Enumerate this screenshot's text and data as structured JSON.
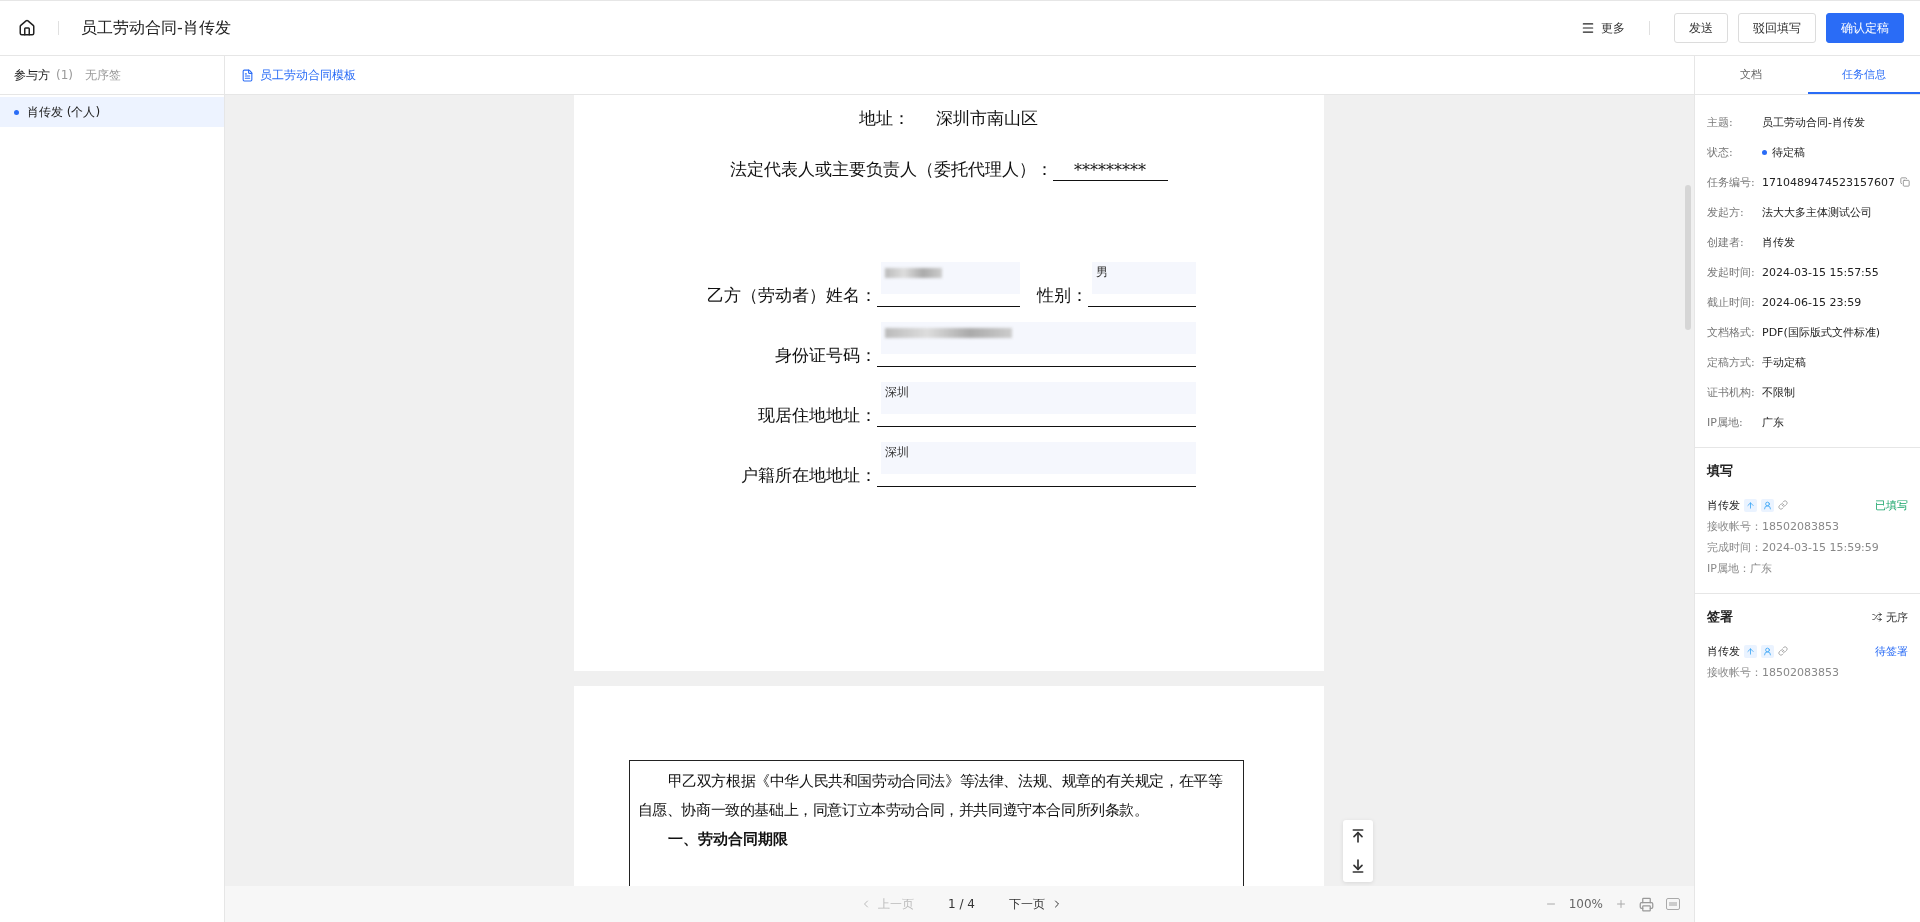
{
  "header": {
    "title": "员工劳动合同-肖传发",
    "more": "更多",
    "buttons": [
      {
        "label": "发送",
        "kind": "default"
      },
      {
        "label": "驳回填写",
        "kind": "default"
      },
      {
        "label": "确认定稿",
        "kind": "primary"
      }
    ]
  },
  "sidebar": {
    "title": "参与方",
    "count": "(1)",
    "mode": "无序签",
    "participants": [
      {
        "name": "肖传发 (个人)",
        "selected": true
      }
    ]
  },
  "document": {
    "file": "员工劳动合同模板",
    "page1": {
      "address_label": "地址：",
      "address": "深圳市南山区",
      "rep_label": "法定代表人或主要负责人（委托代理人）：",
      "rep_value": "*********",
      "name_label": "乙方（劳动者）姓名：",
      "name_field": {
        "kind": "redacted"
      },
      "gender_label": "性别：",
      "gender_field": {
        "kind": "text",
        "value": "男"
      },
      "rows": [
        {
          "label": "身份证号码：",
          "field": {
            "kind": "redacted"
          }
        },
        {
          "label": "现居住地地址：",
          "field": {
            "kind": "text",
            "value": "深圳"
          }
        },
        {
          "label": "户籍所在地地址：",
          "field": {
            "kind": "text",
            "value": "深圳"
          }
        }
      ]
    },
    "page2": {
      "paragraph": "甲乙双方根据《中华人民共和国劳动合同法》等法律、法规、规章的有关规定，在平等自愿、协商一致的基础上，同意订立本劳动合同，并共同遵守本合同所列条款。",
      "heading": "一、劳动合同期限"
    }
  },
  "pager": {
    "prev": {
      "label": "上一页",
      "disabled": true
    },
    "page": "1 / 4",
    "next": {
      "label": "下一页",
      "disabled": false
    },
    "zoom": "100%"
  },
  "panel": {
    "tabs": [
      {
        "label": "文档",
        "selected": false
      },
      {
        "label": "任务信息",
        "selected": true
      }
    ],
    "info": [
      {
        "label": "主题:",
        "value": "员工劳动合同-肖传发",
        "kind": "text"
      },
      {
        "label": "状态:",
        "value": "待定稿",
        "kind": "status",
        "color": "#2a6cf6"
      },
      {
        "label": "任务编号:",
        "value": "1710489474523157607",
        "kind": "copy"
      },
      {
        "label": "发起方:",
        "value": "法大大多主体测试公司",
        "kind": "text"
      },
      {
        "label": "创建者:",
        "value": "肖传发",
        "kind": "text"
      },
      {
        "label": "发起时间:",
        "value": "2024-03-15 15:57:55",
        "kind": "text"
      },
      {
        "label": "截止时间:",
        "value": "2024-06-15 23:59",
        "kind": "text"
      },
      {
        "label": "文档格式:",
        "value": "PDF(国际版式文件标准)",
        "kind": "text"
      },
      {
        "label": "定稿方式:",
        "value": "手动定稿",
        "kind": "text"
      },
      {
        "label": "证书机构:",
        "value": "不限制",
        "kind": "text"
      },
      {
        "label": "IP属地:",
        "value": "广东",
        "kind": "text"
      }
    ],
    "sections": [
      {
        "title": "填写",
        "person": "肖传发",
        "status": "已填写",
        "kind": "done",
        "lines": [
          "接收帐号：18502083853",
          "完成时间：2024-03-15 15:59:59",
          "IP属地：广东"
        ]
      },
      {
        "title": "签署",
        "order": "无序",
        "person": "肖传发",
        "status": "待签署",
        "kind": "pending",
        "lines": [
          "接收帐号：18502083853"
        ]
      }
    ]
  }
}
